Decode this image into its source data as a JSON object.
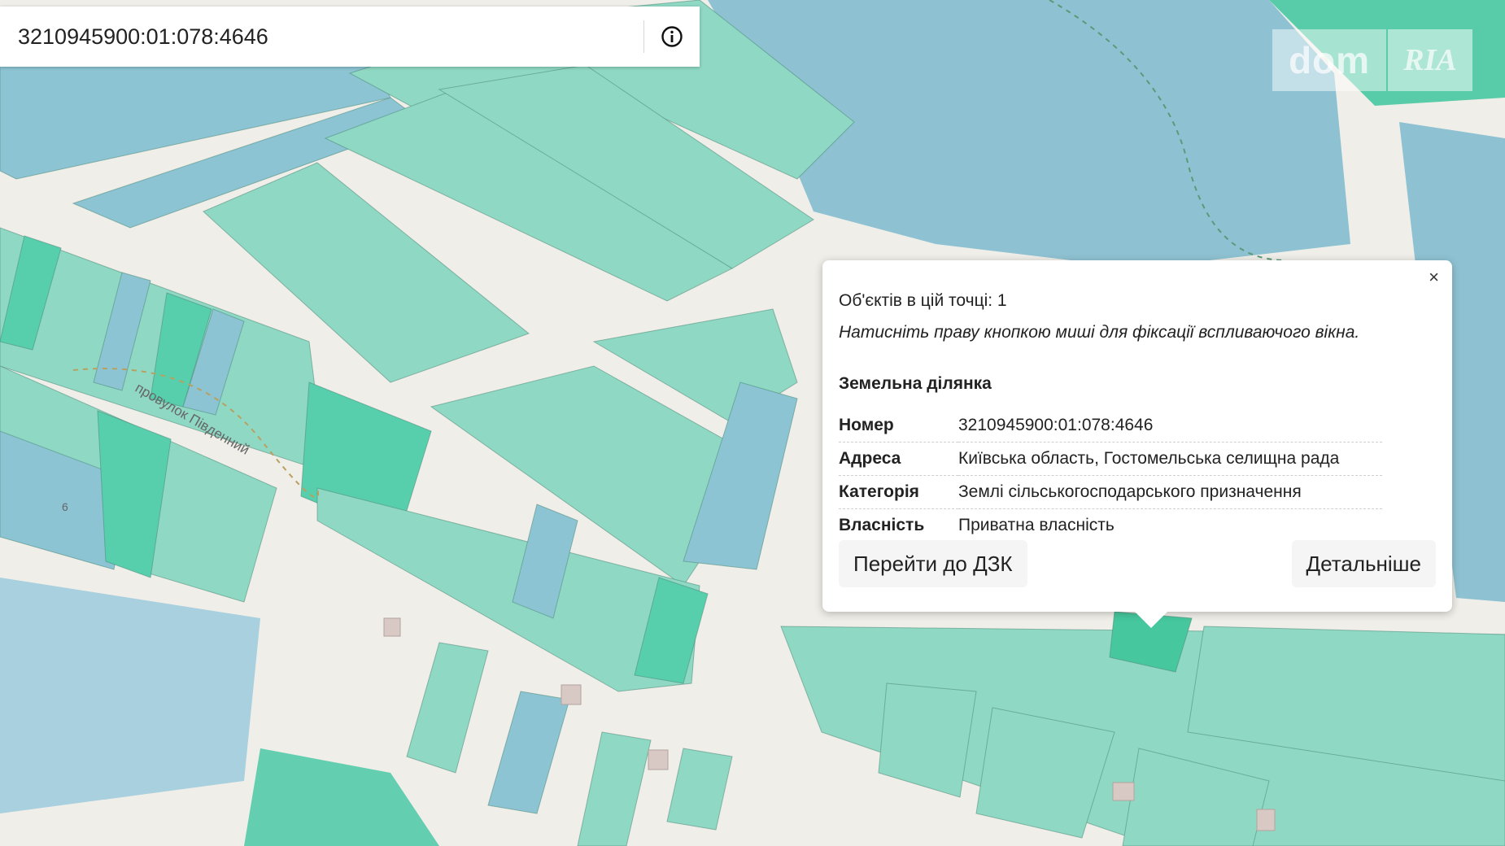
{
  "search": {
    "value": "3210945900:01:078:4646",
    "info_icon": "info-icon"
  },
  "logo": {
    "dom": "dom",
    "ria": "RIA"
  },
  "map": {
    "street_label": "провулок Південний",
    "house_number": "6",
    "colors": {
      "parcel_green": "#8fd8c4",
      "parcel_dark": "#57cfac",
      "parcel_blue": "#8cc4d4",
      "parcel_selected": "#46c79d",
      "water": "#8ec2d2",
      "road": "#f0eee8"
    }
  },
  "popup": {
    "close": "×",
    "count": "Об'єктів в цій точці: 1",
    "hint": "Натисніть праву кнопкою миші для фіксації вспливаючого вікна.",
    "heading": "Земельна ділянка",
    "rows": [
      {
        "key": "Номер",
        "value": "3210945900:01:078:4646"
      },
      {
        "key": "Адреса",
        "value": "Київська область, Гостомельська селищна рада"
      },
      {
        "key": "Категорія",
        "value": "Землі сільськогосподарського призначення"
      },
      {
        "key": "Власність",
        "value": "Приватна власність"
      }
    ],
    "btn_dzk": "Перейти до ДЗК",
    "btn_more": "Детальніше"
  }
}
